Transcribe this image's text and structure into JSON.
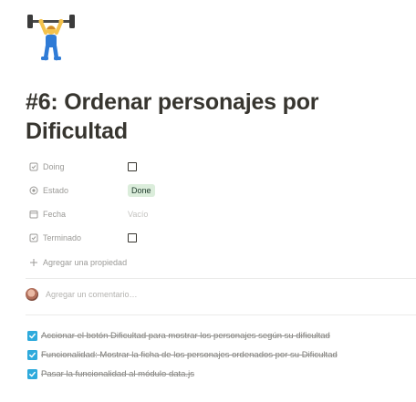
{
  "page": {
    "icon": "person-lifting-weights-emoji",
    "title": "#6: Ordenar personajes por Dificultad"
  },
  "properties": [
    {
      "icon": "checkbox-icon",
      "name": "Doing",
      "type": "checkbox",
      "checked": false
    },
    {
      "icon": "status-icon",
      "name": "Estado",
      "type": "status",
      "value": "Done",
      "color": "#dbeddb"
    },
    {
      "icon": "calendar-icon",
      "name": "Fecha",
      "type": "date",
      "value": "Vacío"
    },
    {
      "icon": "checkbox-icon",
      "name": "Terminado",
      "type": "checkbox",
      "checked": false
    }
  ],
  "add_property_label": "Agregar una propiedad",
  "comment": {
    "placeholder": "Agregar un comentario…"
  },
  "todos": [
    {
      "text": "Accionar el botón Dificultad para mostrar los personajes según su dificultad",
      "checked": true
    },
    {
      "text": "Funcionalidad: Mostrar la ficha de los personajes ordenados por su Dificultad",
      "checked": true
    },
    {
      "text": "Pasar la funcionalidad al módulo data.js",
      "checked": true
    }
  ],
  "colors": {
    "accent_checkbox": "#2eaadc",
    "status_done_bg": "#dbeddb",
    "text": "#37352f",
    "muted": "#9b9a97"
  }
}
